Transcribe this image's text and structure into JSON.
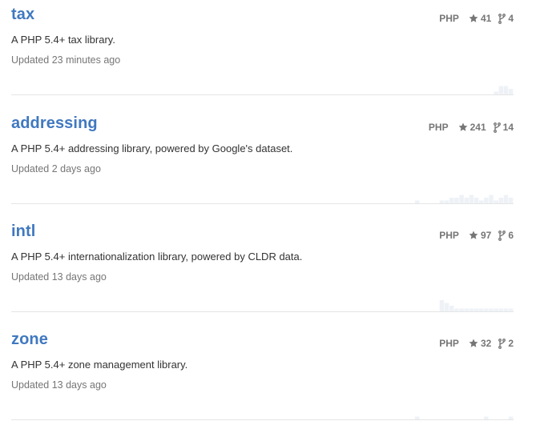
{
  "repos": [
    {
      "name": "tax",
      "description": "A PHP 5.4+ tax library.",
      "updated": "Updated 23 minutes ago",
      "language": "PHP",
      "stars": "41",
      "forks": "4",
      "activity": [
        0,
        0,
        0,
        0,
        0,
        0,
        0,
        0,
        0,
        0,
        0,
        0,
        0,
        0,
        0,
        0,
        0,
        0,
        0,
        0,
        0,
        0,
        1,
        3,
        3,
        2
      ]
    },
    {
      "name": "addressing",
      "description": "A PHP 5.4+ addressing library, powered by Google's dataset.",
      "updated": "Updated 2 days ago",
      "language": "PHP",
      "stars": "241",
      "forks": "14",
      "activity": [
        0,
        0,
        0,
        0,
        0,
        0,
        1,
        0,
        0,
        0,
        0,
        1,
        1,
        2,
        2,
        3,
        2,
        3,
        2,
        1,
        2,
        3,
        1,
        2,
        3,
        2
      ]
    },
    {
      "name": "intl",
      "description": "A PHP 5.4+ internationalization library, powered by CLDR data.",
      "updated": "Updated 13 days ago",
      "language": "PHP",
      "stars": "97",
      "forks": "6",
      "activity": [
        0,
        0,
        0,
        0,
        0,
        0,
        0,
        0,
        0,
        0,
        0,
        4,
        3,
        2,
        1,
        1,
        1,
        1,
        1,
        1,
        1,
        1,
        1,
        1,
        1,
        1
      ]
    },
    {
      "name": "zone",
      "description": "A PHP 5.4+ zone management library.",
      "updated": "Updated 13 days ago",
      "language": "PHP",
      "stars": "32",
      "forks": "2",
      "activity": [
        0,
        0,
        0,
        0,
        0,
        0,
        1,
        0,
        0,
        0,
        0,
        0,
        0,
        0,
        0,
        0,
        0,
        0,
        0,
        0,
        1,
        0,
        0,
        0,
        0,
        1
      ]
    }
  ],
  "colors": {
    "link": "#4078c0",
    "muted": "#767676",
    "text": "#333333",
    "divider": "#e5e5e5",
    "sparkline": "#eef2f7"
  },
  "icons": {
    "stars": "star-icon",
    "forks": "fork-icon"
  }
}
